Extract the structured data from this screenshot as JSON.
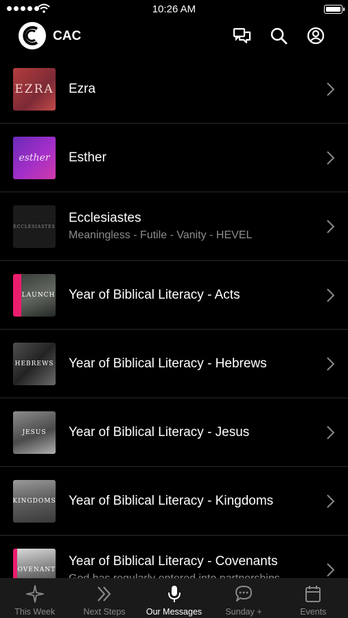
{
  "status_bar": {
    "time": "10:26 AM",
    "icons": [
      "signal-dots-icon",
      "wifi-icon",
      "battery-icon"
    ]
  },
  "header": {
    "brand": "CAC",
    "icons": [
      "logo-icon",
      "chat-bubbles-icon",
      "search-icon",
      "account-icon"
    ]
  },
  "series": [
    {
      "title": "Ezra",
      "subtitle": "",
      "thumb_text": "EZRA"
    },
    {
      "title": "Esther",
      "subtitle": "",
      "thumb_text": "esther"
    },
    {
      "title": "Ecclesiastes",
      "subtitle": "Meaningless - Futile - Vanity - HEVEL",
      "thumb_text": "ECCLESIASTES"
    },
    {
      "title": "Year of Biblical Literacy - Acts",
      "subtitle": "",
      "thumb_text": "LAUNCH"
    },
    {
      "title": "Year of Biblical Literacy - Hebrews",
      "subtitle": "",
      "thumb_text": "HEBREWS"
    },
    {
      "title": "Year of Biblical Literacy - Jesus",
      "subtitle": "",
      "thumb_text": "JESUS"
    },
    {
      "title": "Year of Biblical Literacy - Kingdoms",
      "subtitle": "",
      "thumb_text": "KINGDOMS"
    },
    {
      "title": "Year of Biblical Literacy - Covenants",
      "subtitle": "God has regularly entered into partnerships",
      "thumb_text": "COVENANTS"
    }
  ],
  "tabbar": {
    "tabs": [
      {
        "label": "This Week",
        "icon": "sparkle-icon",
        "active": false
      },
      {
        "label": "Next Steps",
        "icon": "double-chevron-icon",
        "active": false
      },
      {
        "label": "Our Messages",
        "icon": "microphone-icon",
        "active": true
      },
      {
        "label": "Sunday +",
        "icon": "chat-bubble-icon",
        "active": false
      },
      {
        "label": "Events",
        "icon": "calendar-icon",
        "active": false
      }
    ]
  },
  "colors": {
    "background": "#000000",
    "tabbar": "#1a1a1a",
    "accent": "#ec1d6d",
    "subtitle": "#8d8d8d"
  }
}
